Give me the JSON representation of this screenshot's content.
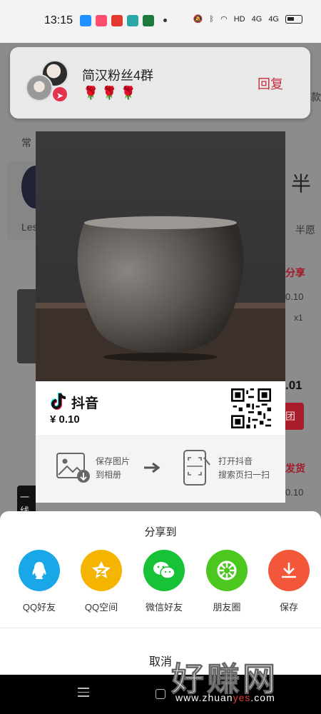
{
  "status_bar": {
    "time": "13:15",
    "app_icon_colors": [
      "#1e90ff",
      "#ff4d6d",
      "#e23a2e",
      "#2aa7a7",
      "#1e7a3c"
    ],
    "network": "HD",
    "signal_1": "4G",
    "signal_2": "4G"
  },
  "notification": {
    "title": "简汉粉丝4群",
    "message": "🌹🌹🌹",
    "reply_label": "回复"
  },
  "background": {
    "section_label": "常",
    "right_char": "半",
    "left_text": "Les",
    "right_text": "半愿",
    "share_text": "分享",
    "price_1": "0.10",
    "qty": "x1",
    "total": ".01",
    "group_btn": "团",
    "ship_text": "发货",
    "price_2": "0.10",
    "thumb_text": "一线",
    "partial_right": "款"
  },
  "poster": {
    "brand": "抖音",
    "price": "¥ 0.10",
    "tip_left_line1": "保存图片",
    "tip_left_line2": "到相册",
    "tip_right_line1": "打开抖音",
    "tip_right_line2": "搜索页扫一扫"
  },
  "share_sheet": {
    "title": "分享到",
    "items": [
      {
        "label": "QQ好友",
        "color": "#1aa7e8",
        "icon": "qq-icon"
      },
      {
        "label": "QQ空间",
        "color": "#f5b400",
        "icon": "qzone-icon"
      },
      {
        "label": "微信好友",
        "color": "#17c236",
        "icon": "wechat-icon"
      },
      {
        "label": "朋友圈",
        "color": "#4cc71f",
        "icon": "moments-icon"
      },
      {
        "label": "保存",
        "color": "#f2573a",
        "icon": "download-icon"
      }
    ],
    "cancel_label": "取消"
  },
  "watermark": {
    "big": "好赚网",
    "site_prefix": "www.zhuan",
    "site_highlight": "yes",
    "site_suffix": ".com"
  }
}
